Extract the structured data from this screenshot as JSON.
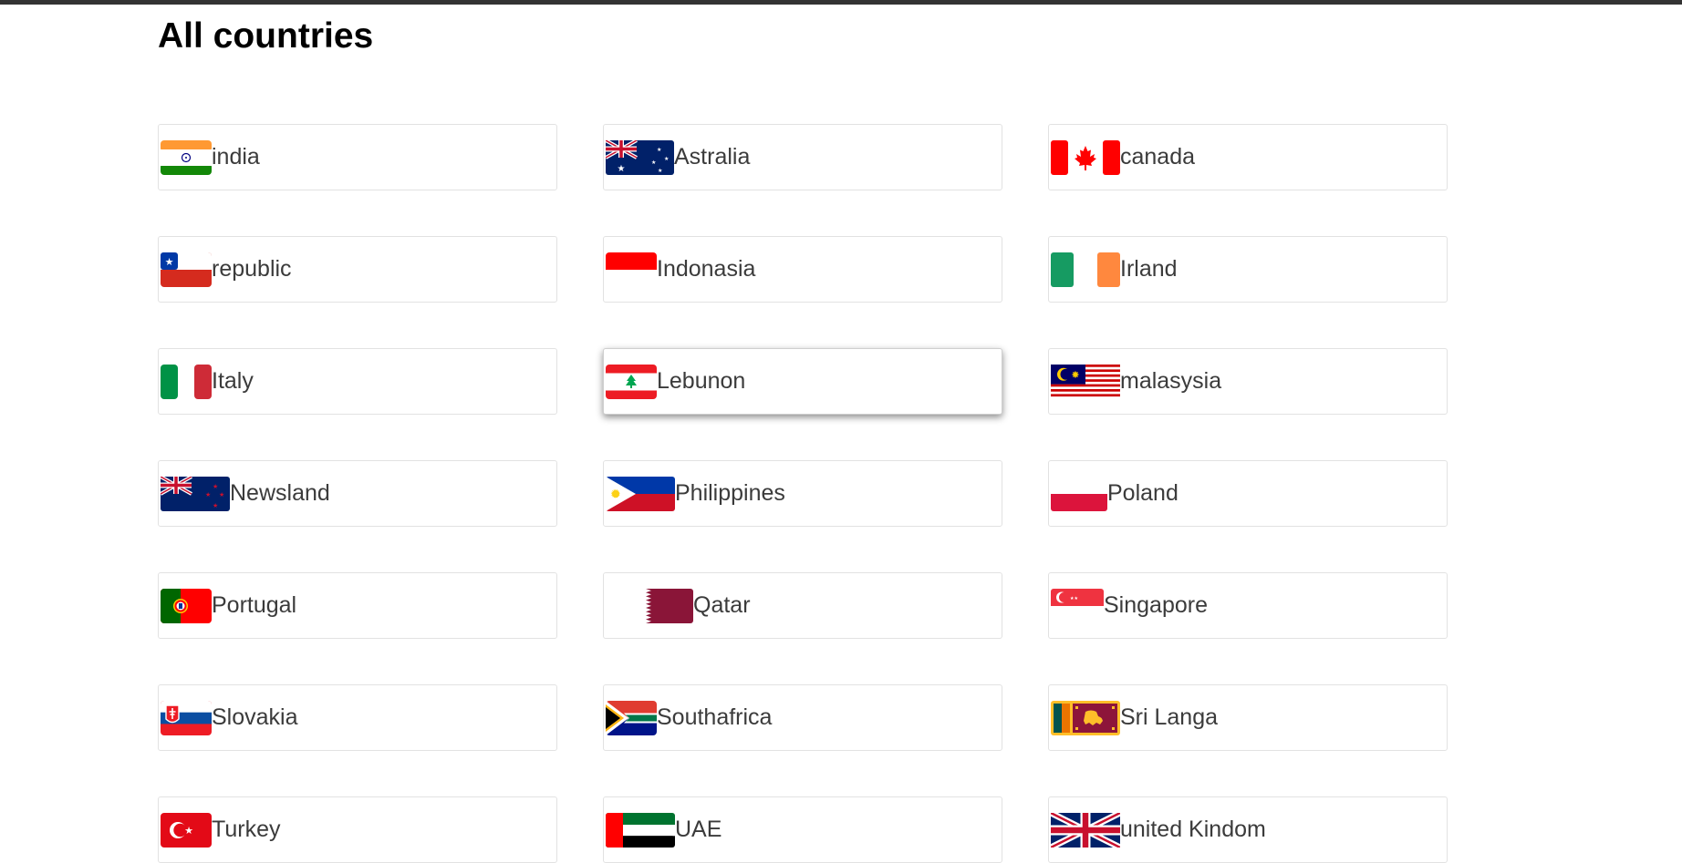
{
  "page": {
    "title": "All countries"
  },
  "colors": {
    "topbar": "#333333",
    "card_border": "#e2e2e2",
    "text": "#3b3b3b"
  },
  "countries": [
    {
      "label": "india",
      "flag_icon": "india-flag-icon"
    },
    {
      "label": "Astralia",
      "flag_icon": "australia-flag-icon"
    },
    {
      "label": "canada",
      "flag_icon": "canada-flag-icon"
    },
    {
      "label": "republic",
      "flag_icon": "chile-flag-icon"
    },
    {
      "label": "Indonasia",
      "flag_icon": "indonesia-flag-icon"
    },
    {
      "label": "Irland",
      "flag_icon": "ireland-flag-icon"
    },
    {
      "label": "Italy",
      "flag_icon": "italy-flag-icon"
    },
    {
      "label": "Lebunon",
      "flag_icon": "lebanon-flag-icon",
      "selected": true
    },
    {
      "label": "malasysia",
      "flag_icon": "malaysia-flag-icon"
    },
    {
      "label": "Newsland",
      "flag_icon": "new-zealand-flag-icon"
    },
    {
      "label": "Philippines",
      "flag_icon": "philippines-flag-icon"
    },
    {
      "label": "Poland",
      "flag_icon": "poland-flag-icon"
    },
    {
      "label": "Portugal",
      "flag_icon": "portugal-flag-icon"
    },
    {
      "label": "Qatar",
      "flag_icon": "qatar-flag-icon"
    },
    {
      "label": "Singapore",
      "flag_icon": "singapore-flag-icon"
    },
    {
      "label": "Slovakia",
      "flag_icon": "slovakia-flag-icon"
    },
    {
      "label": "Southafrica",
      "flag_icon": "south-africa-flag-icon"
    },
    {
      "label": "Sri Langa",
      "flag_icon": "sri-lanka-flag-icon"
    },
    {
      "label": "Turkey",
      "flag_icon": "turkey-flag-icon"
    },
    {
      "label": "UAE",
      "flag_icon": "uae-flag-icon"
    },
    {
      "label": "united Kindom",
      "flag_icon": "united-kingdom-flag-icon"
    }
  ]
}
